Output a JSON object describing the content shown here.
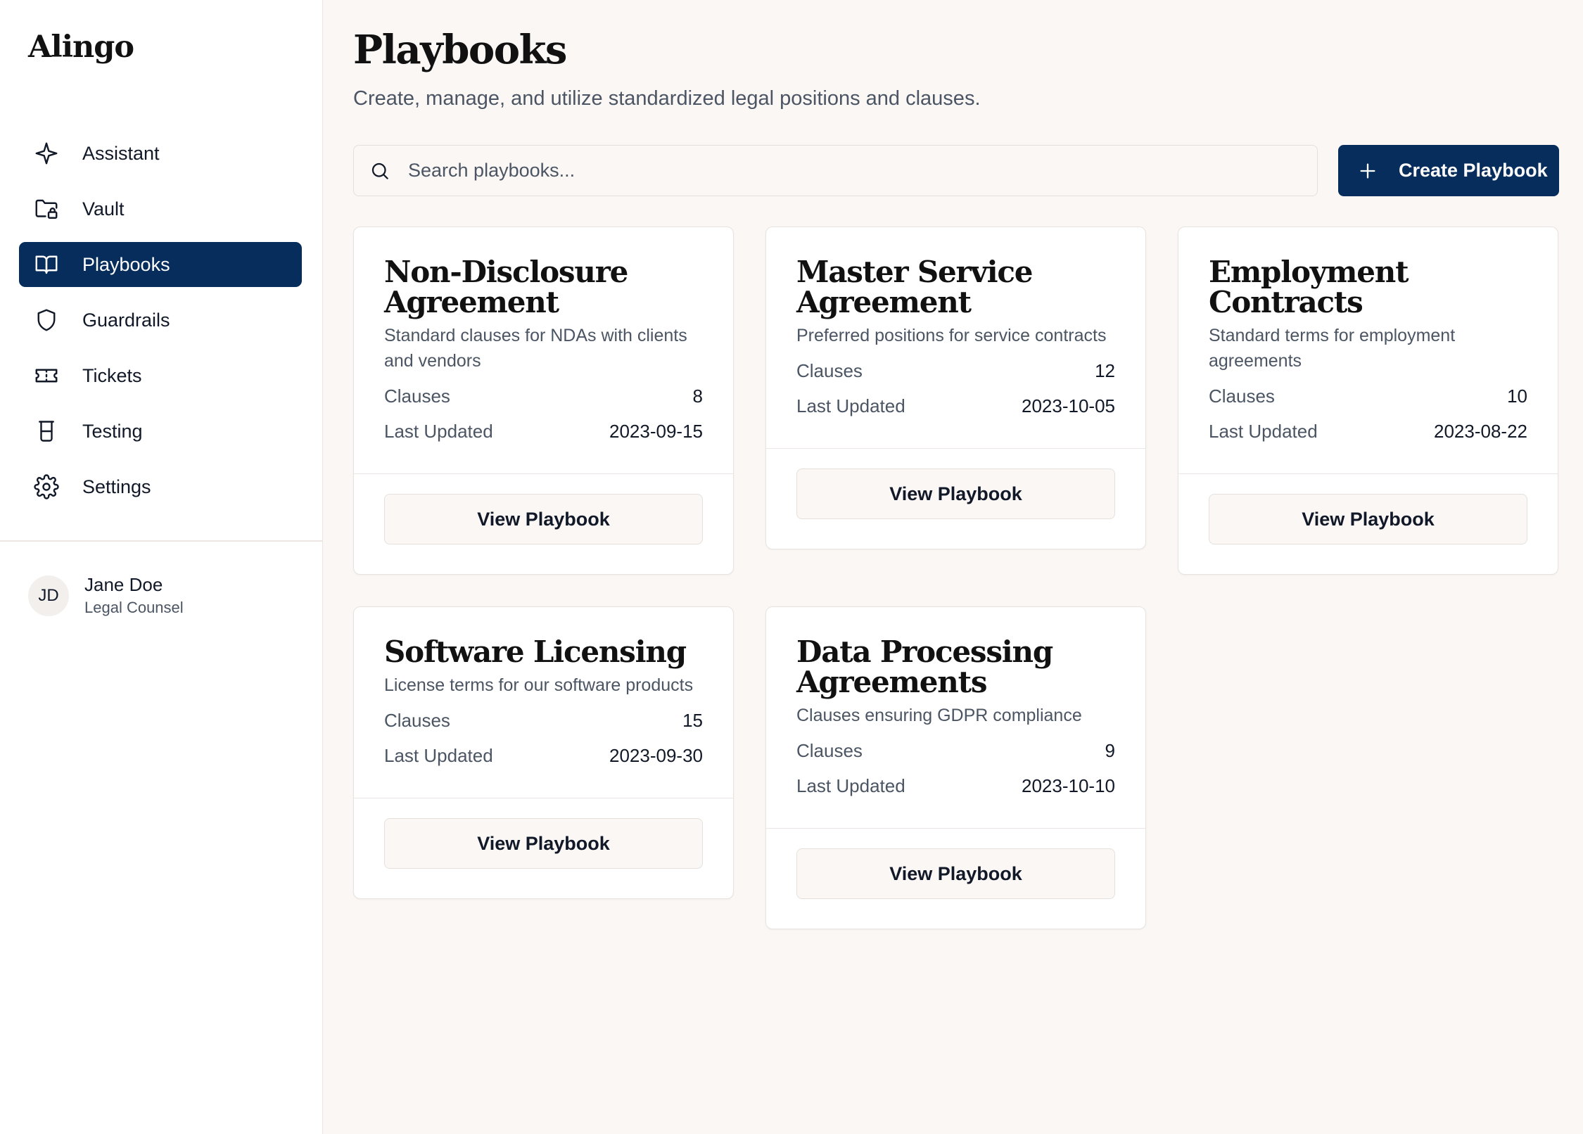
{
  "app": {
    "name": "Alingo"
  },
  "sidebar": {
    "items": [
      {
        "label": "Assistant",
        "icon": "sparkle-icon"
      },
      {
        "label": "Vault",
        "icon": "folder-lock-icon"
      },
      {
        "label": "Playbooks",
        "icon": "book-open-icon",
        "active": true
      },
      {
        "label": "Guardrails",
        "icon": "shield-icon"
      },
      {
        "label": "Tickets",
        "icon": "ticket-icon"
      },
      {
        "label": "Testing",
        "icon": "beaker-icon"
      },
      {
        "label": "Settings",
        "icon": "gear-icon"
      }
    ],
    "user": {
      "initials": "JD",
      "name": "Jane Doe",
      "role": "Legal Counsel"
    }
  },
  "header": {
    "title": "Playbooks",
    "subtitle": "Create, manage, and utilize standardized legal positions and clauses."
  },
  "search": {
    "placeholder": "Search playbooks...",
    "value": ""
  },
  "toolbar": {
    "create_label": "Create Playbook"
  },
  "colors": {
    "accent": "#062d5c",
    "background": "#faf7f5",
    "muted_text": "#4b5563"
  },
  "cards": [
    {
      "title": "Non-Disclosure Agreement",
      "description": "Standard clauses for NDAs with clients and vendors",
      "clauses_label": "Clauses",
      "clauses": "8",
      "updated_label": "Last Updated",
      "updated": "2023-09-15",
      "button": "View Playbook"
    },
    {
      "title": "Master Service Agreement",
      "description": "Preferred positions for service contracts",
      "clauses_label": "Clauses",
      "clauses": "12",
      "updated_label": "Last Updated",
      "updated": "2023-10-05",
      "button": "View Playbook"
    },
    {
      "title": "Employment Contracts",
      "description": "Standard terms for employment agreements",
      "clauses_label": "Clauses",
      "clauses": "10",
      "updated_label": "Last Updated",
      "updated": "2023-08-22",
      "button": "View Playbook"
    },
    {
      "title": "Software Licensing",
      "description": "License terms for our software products",
      "clauses_label": "Clauses",
      "clauses": "15",
      "updated_label": "Last Updated",
      "updated": "2023-09-30",
      "button": "View Playbook"
    },
    {
      "title": "Data Processing Agreements",
      "description": "Clauses ensuring GDPR compliance",
      "clauses_label": "Clauses",
      "clauses": "9",
      "updated_label": "Last Updated",
      "updated": "2023-10-10",
      "button": "View Playbook"
    }
  ]
}
